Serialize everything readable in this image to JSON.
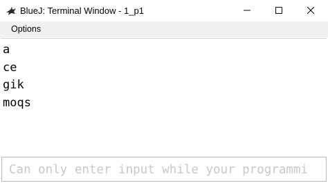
{
  "window": {
    "title": "BlueJ: Terminal Window - 1_p1",
    "app_icon": "bluej-bird-icon",
    "controls": {
      "minimize_icon": "minimize-icon",
      "maximize_icon": "maximize-icon",
      "close_icon": "close-icon"
    }
  },
  "menubar": {
    "items": [
      {
        "label": "Options"
      }
    ]
  },
  "terminal": {
    "output_lines": [
      "a",
      "ce",
      "gik",
      "moqs"
    ],
    "input_placeholder": "Can only enter input while your programmi"
  },
  "colors": {
    "titlebar_bg": "#ffffff",
    "menubar_bg": "#f0f0f0",
    "output_text": "#000000",
    "placeholder_text": "#c8c8c8"
  }
}
